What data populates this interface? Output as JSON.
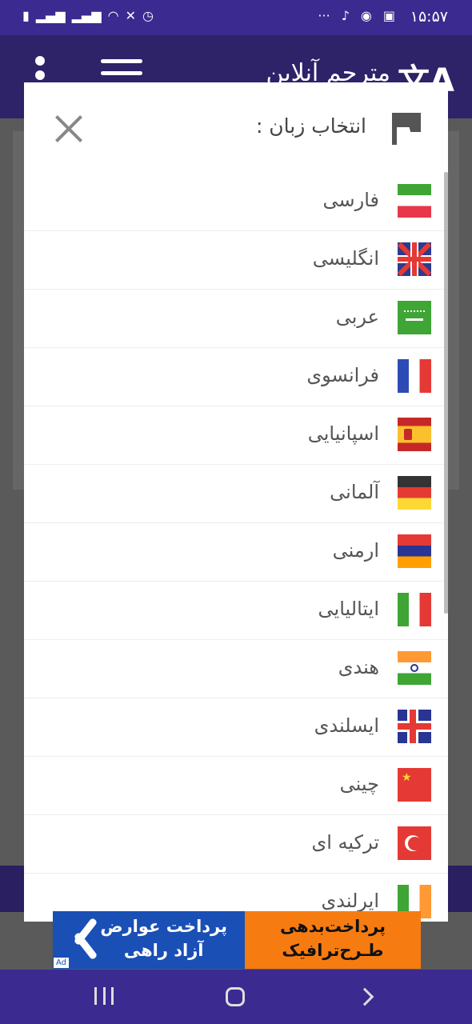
{
  "status_bar": {
    "time": "۱۵:۵۷",
    "more": "···"
  },
  "app": {
    "title": "مترجم آنلاین"
  },
  "dialog": {
    "title": "انتخاب زبان :",
    "languages": [
      {
        "label": "فارسی",
        "flag": "iran-flag-icon"
      },
      {
        "label": "انگلیسی",
        "flag": "uk-flag-icon"
      },
      {
        "label": "عربی",
        "flag": "saudi-flag-icon"
      },
      {
        "label": "فرانسوی",
        "flag": "france-flag-icon"
      },
      {
        "label": "اسپانیایی",
        "flag": "spain-flag-icon"
      },
      {
        "label": "آلمانی",
        "flag": "germany-flag-icon"
      },
      {
        "label": "ارمنی",
        "flag": "armenia-flag-icon"
      },
      {
        "label": "ایتالیایی",
        "flag": "italy-flag-icon"
      },
      {
        "label": "هندی",
        "flag": "india-flag-icon"
      },
      {
        "label": "ایسلندی",
        "flag": "iceland-flag-icon"
      },
      {
        "label": "چینی",
        "flag": "china-flag-icon"
      },
      {
        "label": "ترکیه ای",
        "flag": "turkey-flag-icon"
      },
      {
        "label": "ایرلندی",
        "flag": "ireland-flag-icon"
      }
    ]
  },
  "ad": {
    "left_line1": "پرداخت عوارض",
    "left_line2": "آزاد راهی",
    "right_line1": "پرداخت‌بدهی",
    "right_line2": "طـرح‌ترافیک",
    "badge": "Ad"
  },
  "colors": {
    "status_bar": "#3b2a8f",
    "app_bar": "#2e2268",
    "ad_blue": "#1a4fb5",
    "ad_orange": "#f67c12"
  }
}
